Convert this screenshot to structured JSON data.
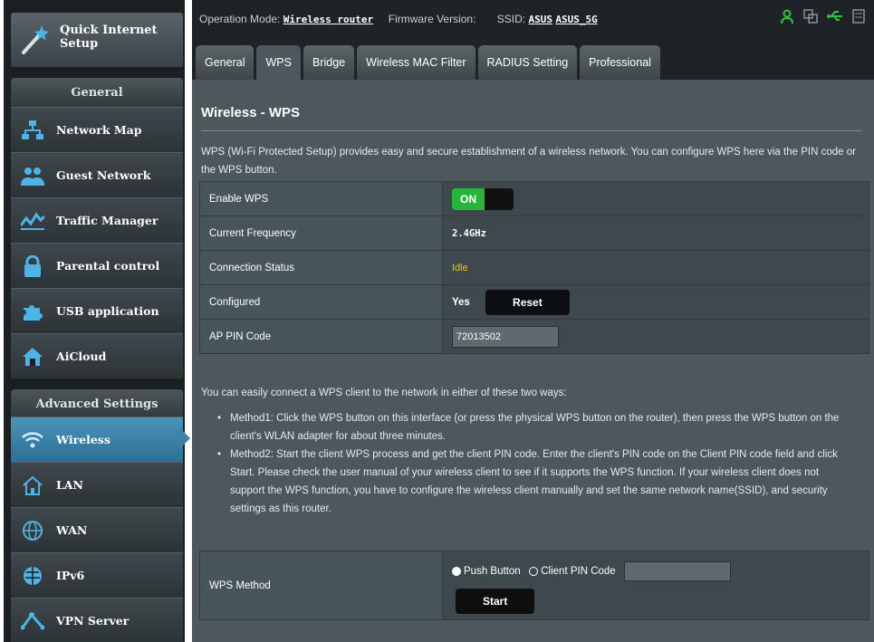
{
  "sidebar": {
    "quick_setup_label_1": "Quick Internet",
    "quick_setup_label_2": "Setup",
    "general_heading": "General",
    "general_items": [
      {
        "label": "Network Map",
        "icon": "network-map-icon"
      },
      {
        "label": "Guest Network",
        "icon": "guest-network-icon"
      },
      {
        "label": "Traffic Manager",
        "icon": "traffic-manager-icon"
      },
      {
        "label": "Parental control",
        "icon": "lock-icon"
      },
      {
        "label": "USB application",
        "icon": "puzzle-icon"
      },
      {
        "label": "AiCloud",
        "icon": "cloud-house-icon"
      }
    ],
    "advanced_heading": "Advanced Settings",
    "advanced_items": [
      {
        "label": "Wireless",
        "icon": "wifi-icon",
        "active": true
      },
      {
        "label": "LAN",
        "icon": "home-icon"
      },
      {
        "label": "WAN",
        "icon": "globe-icon"
      },
      {
        "label": "IPv6",
        "icon": "ipv6-globe-icon"
      },
      {
        "label": "VPN Server",
        "icon": "vpn-icon"
      }
    ]
  },
  "topbar": {
    "operation_mode_label": "Operation Mode:",
    "operation_mode_value": "Wireless router",
    "firmware_label": "Firmware Version:",
    "ssid_label": "SSID:",
    "ssid_1": "ASUS",
    "ssid_2": "ASUS_5G",
    "status_icons": [
      "user-icon",
      "copy-icon",
      "usb-icon",
      "printer-icon"
    ]
  },
  "tabs": [
    "General",
    "WPS",
    "Bridge",
    "Wireless MAC Filter",
    "RADIUS Setting",
    "Professional"
  ],
  "active_tab": "WPS",
  "page": {
    "title": "Wireless - WPS",
    "description": "WPS (Wi-Fi Protected Setup) provides easy and secure establishment of a wireless network. You can configure WPS here via the PIN code or the WPS button."
  },
  "form": {
    "enable_wps_label": "Enable WPS",
    "enable_wps_value": "ON",
    "frequency_label": "Current Frequency",
    "frequency_value": "2.4GHz",
    "connection_status_label": "Connection Status",
    "connection_status_value": "Idle",
    "configured_label": "Configured",
    "configured_value": "Yes",
    "reset_button": "Reset",
    "ap_pin_label": "AP PIN Code",
    "ap_pin_value": "72013502"
  },
  "instructions": {
    "intro": "You can easily connect a WPS client to the network in either of these two ways:",
    "method1": "Method1: Click the WPS button on this interface (or press the physical WPS button on the router), then press the WPS button on the client's WLAN adapter for about three minutes.",
    "method2": "Method2: Start the client WPS process and get the client PIN code. Enter the client's PIN code on the Client PIN code field and click Start. Please check the user manual of your wireless client to see if it supports the WPS function. If your wireless client does not support the WPS function, you have to configure the wireless client manually and set the same network name(SSID), and security settings as this router."
  },
  "wps_method": {
    "label": "WPS Method",
    "option_push": "Push Button",
    "option_pin": "Client PIN Code",
    "selected": "Push Button",
    "client_pin_value": "",
    "start_button": "Start"
  },
  "colors": {
    "accent_active": "#3d82ab",
    "toggle_on": "#28b63a",
    "idle_status": "#f0c800",
    "status_icon_green": "#2fc43c"
  }
}
